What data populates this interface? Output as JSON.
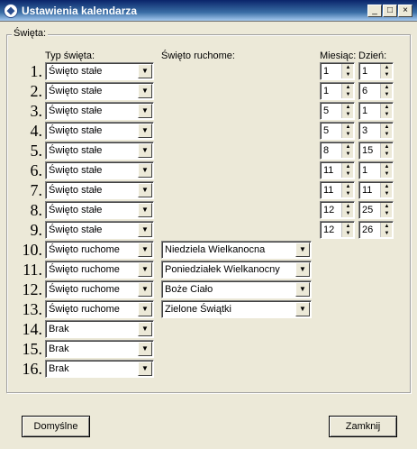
{
  "window": {
    "title": "Ustawienia kalendarza"
  },
  "group_label": "Święta:",
  "headers": {
    "type": "Typ święta:",
    "movable": "Święto ruchome:",
    "month": "Miesiąc:",
    "day": "Dzień:"
  },
  "rows": [
    {
      "num": "1.",
      "type": "Święto stałe",
      "month": "1",
      "day": "1"
    },
    {
      "num": "2.",
      "type": "Święto stałe",
      "month": "1",
      "day": "6"
    },
    {
      "num": "3.",
      "type": "Święto stałe",
      "month": "5",
      "day": "1"
    },
    {
      "num": "4.",
      "type": "Święto stałe",
      "month": "5",
      "day": "3"
    },
    {
      "num": "5.",
      "type": "Święto stałe",
      "month": "8",
      "day": "15"
    },
    {
      "num": "6.",
      "type": "Święto stałe",
      "month": "11",
      "day": "1"
    },
    {
      "num": "7.",
      "type": "Święto stałe",
      "month": "11",
      "day": "11"
    },
    {
      "num": "8.",
      "type": "Święto stałe",
      "month": "12",
      "day": "25"
    },
    {
      "num": "9.",
      "type": "Święto stałe",
      "month": "12",
      "day": "26"
    },
    {
      "num": "10.",
      "type": "Święto ruchome",
      "movable": "Niedziela Wielkanocna"
    },
    {
      "num": "11.",
      "type": "Święto ruchome",
      "movable": "Poniedziałek Wielkanocny"
    },
    {
      "num": "12.",
      "type": "Święto ruchome",
      "movable": "Boże Ciało"
    },
    {
      "num": "13.",
      "type": "Święto ruchome",
      "movable": "Zielone Świątki"
    },
    {
      "num": "14.",
      "type": "Brak"
    },
    {
      "num": "15.",
      "type": "Brak"
    },
    {
      "num": "16.",
      "type": "Brak"
    }
  ],
  "buttons": {
    "default": "Domyślne",
    "close": "Zamknij"
  },
  "icons": {
    "app": "calendar-app-icon",
    "minimize": "minimize-icon",
    "maximize": "maximize-icon",
    "close": "close-icon",
    "dropdown": "chevron-down-icon",
    "spin_up": "arrow-up-icon",
    "spin_down": "arrow-down-icon"
  }
}
